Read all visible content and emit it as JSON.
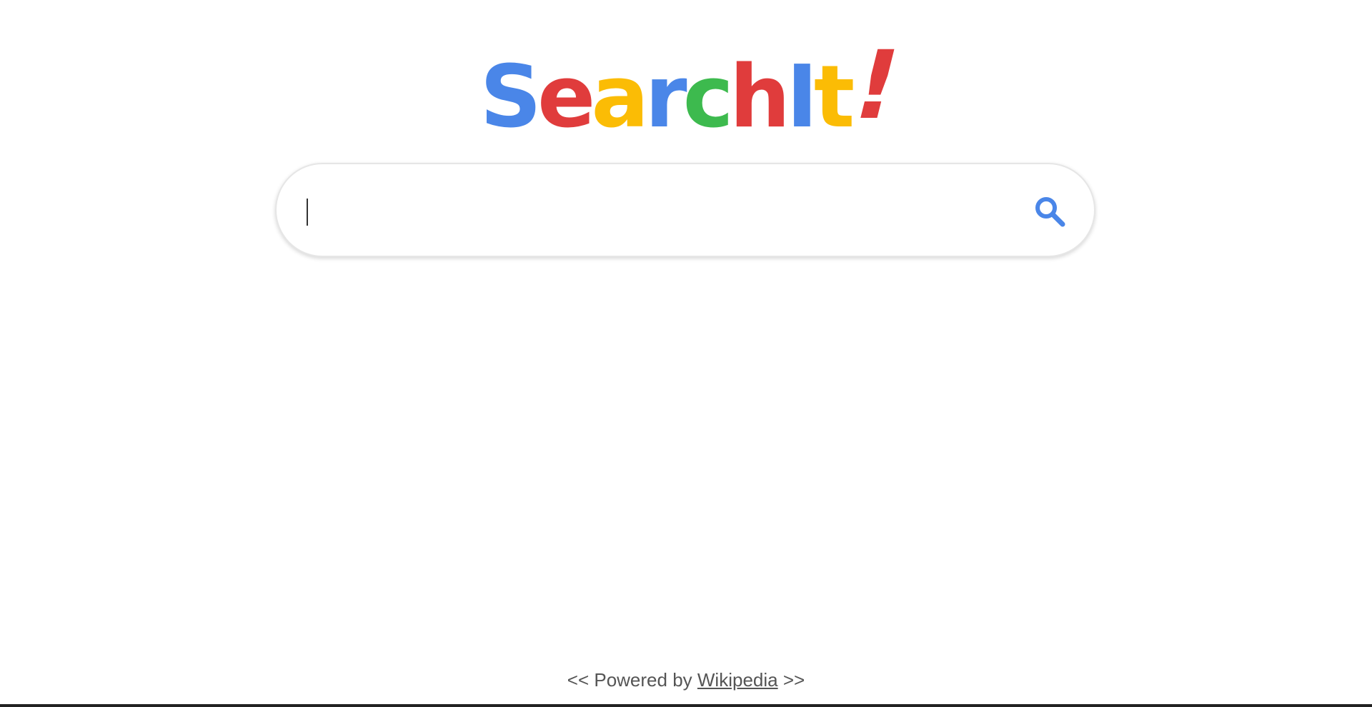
{
  "logo": {
    "letters": [
      {
        "char": "S",
        "color": "#4a86e8"
      },
      {
        "char": "e",
        "color": "#e03c3c"
      },
      {
        "char": "a",
        "color": "#fbbc05"
      },
      {
        "char": "r",
        "color": "#4a86e8"
      },
      {
        "char": "c",
        "color": "#3dba4e"
      },
      {
        "char": "h",
        "color": "#e03c3c"
      },
      {
        "char": "I",
        "color": "#4a86e8"
      },
      {
        "char": "t",
        "color": "#fbbc05"
      },
      {
        "char": "!",
        "color": "#e03c3c"
      }
    ]
  },
  "search": {
    "value": "",
    "placeholder": "",
    "button_icon": "search-icon",
    "icon_color": "#4a86e8"
  },
  "footer": {
    "prefix": "<< Powered by",
    "link_label": "Wikipedia",
    "suffix": ">>"
  }
}
